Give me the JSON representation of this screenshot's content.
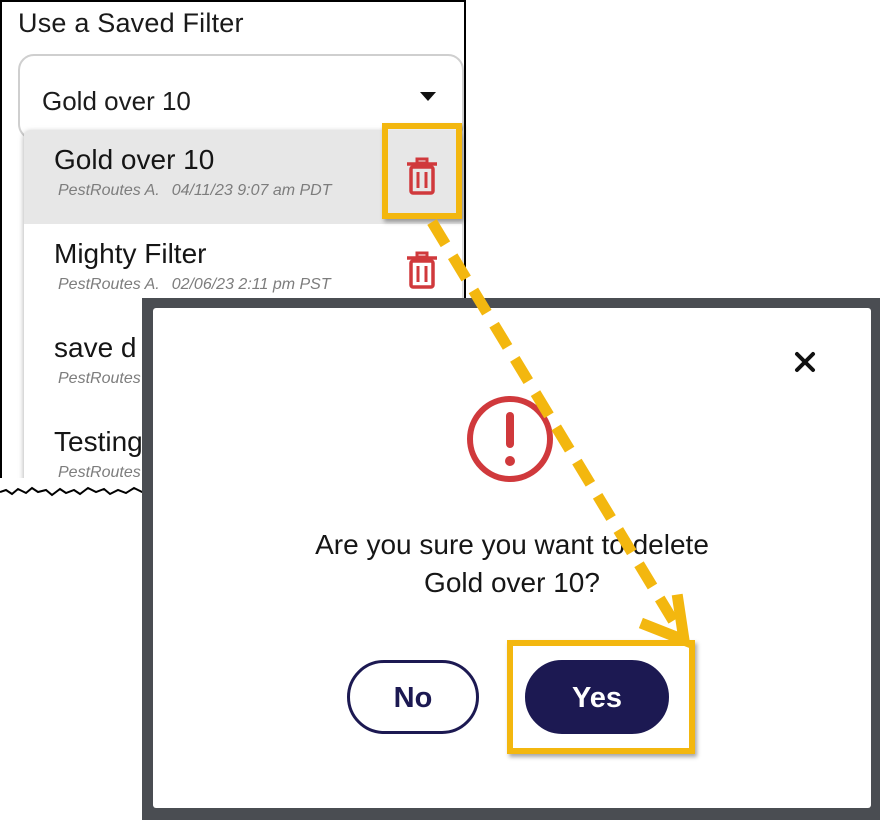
{
  "saved_filter": {
    "title": "Use a Saved Filter",
    "selected_value": "Gold over 10",
    "items": [
      {
        "name": "Gold over 10",
        "author": "PestRoutes A.",
        "date": "04/11/23 9:07 am PDT",
        "selected": true
      },
      {
        "name": "Mighty Filter",
        "author": "PestRoutes A.",
        "date": "02/06/23 2:11 pm PST",
        "selected": false
      },
      {
        "name": "save d",
        "author": "PestRoutes",
        "date": "",
        "selected": false
      },
      {
        "name": "Testing",
        "author": "PestRoutes",
        "date": "",
        "selected": false
      }
    ]
  },
  "modal": {
    "message_line1": "Are you sure you want to delete",
    "message_line2": "Gold over 10?",
    "no_label": "No",
    "yes_label": "Yes",
    "close_icon": "close-icon",
    "alert_icon": "exclamation-circle-icon"
  },
  "colors": {
    "accent_highlight": "#f3b70f",
    "primary_button": "#1c1952",
    "danger_icon": "#d0393c",
    "overlay": "#4a4d52"
  }
}
